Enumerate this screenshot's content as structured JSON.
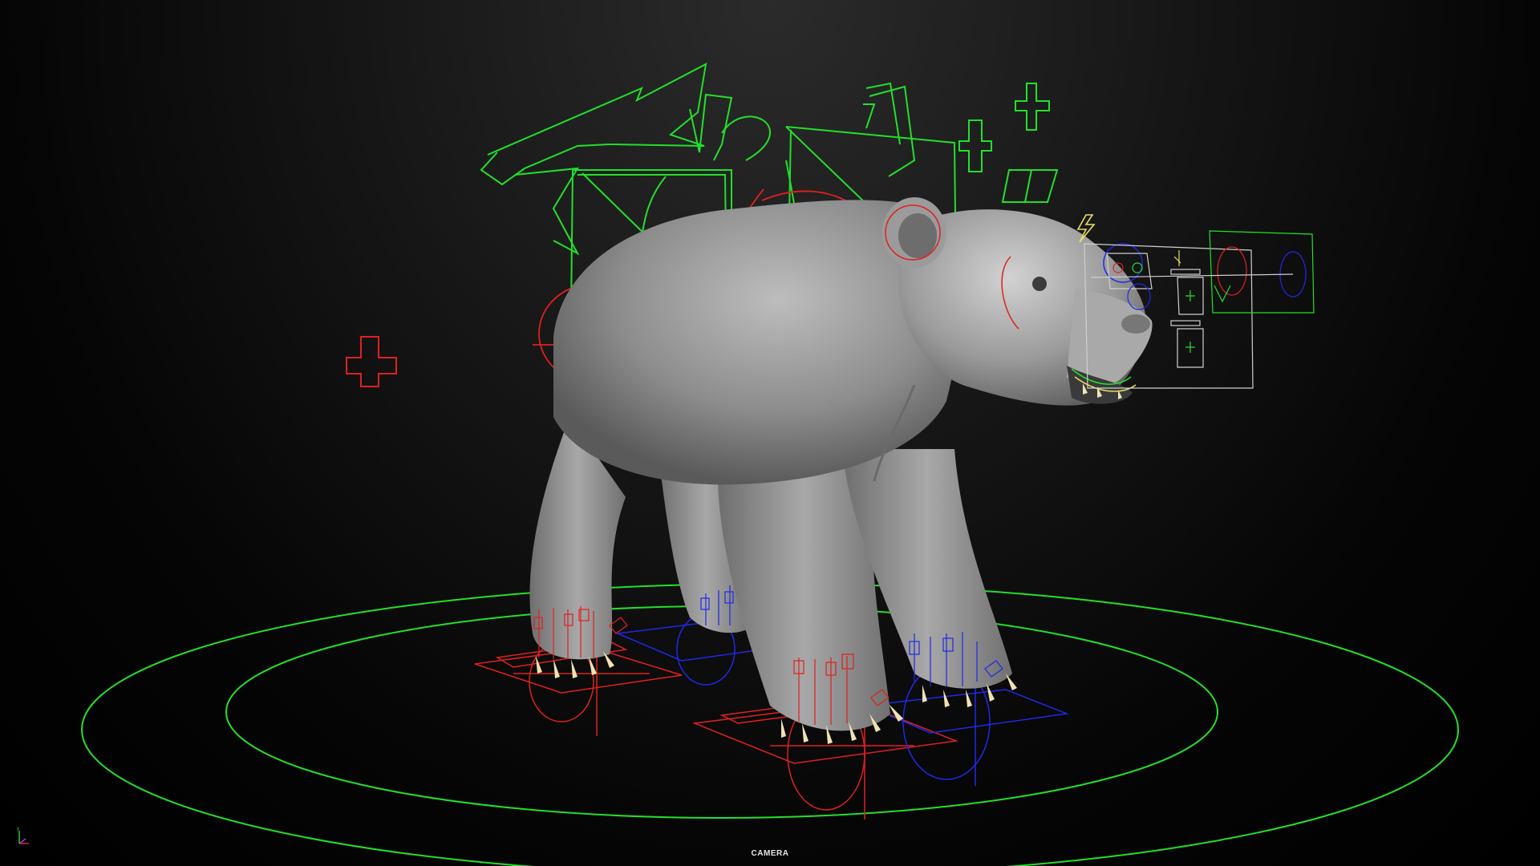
{
  "viewport": {
    "camera_label": "CAMERA"
  },
  "colors": {
    "green_control": "#22e02a",
    "red_control": "#e02020",
    "blue_control": "#2028e8",
    "yellow_control": "#e8e060",
    "white_control": "#cfcfcf",
    "mesh_light": "#b8b8b8",
    "mesh_dark": "#5a5a5a",
    "claw": "#efe3b0"
  },
  "scene": {
    "subject": "bear-rig",
    "icons": [
      "axis-gizmo-icon",
      "lightning-icon"
    ]
  }
}
